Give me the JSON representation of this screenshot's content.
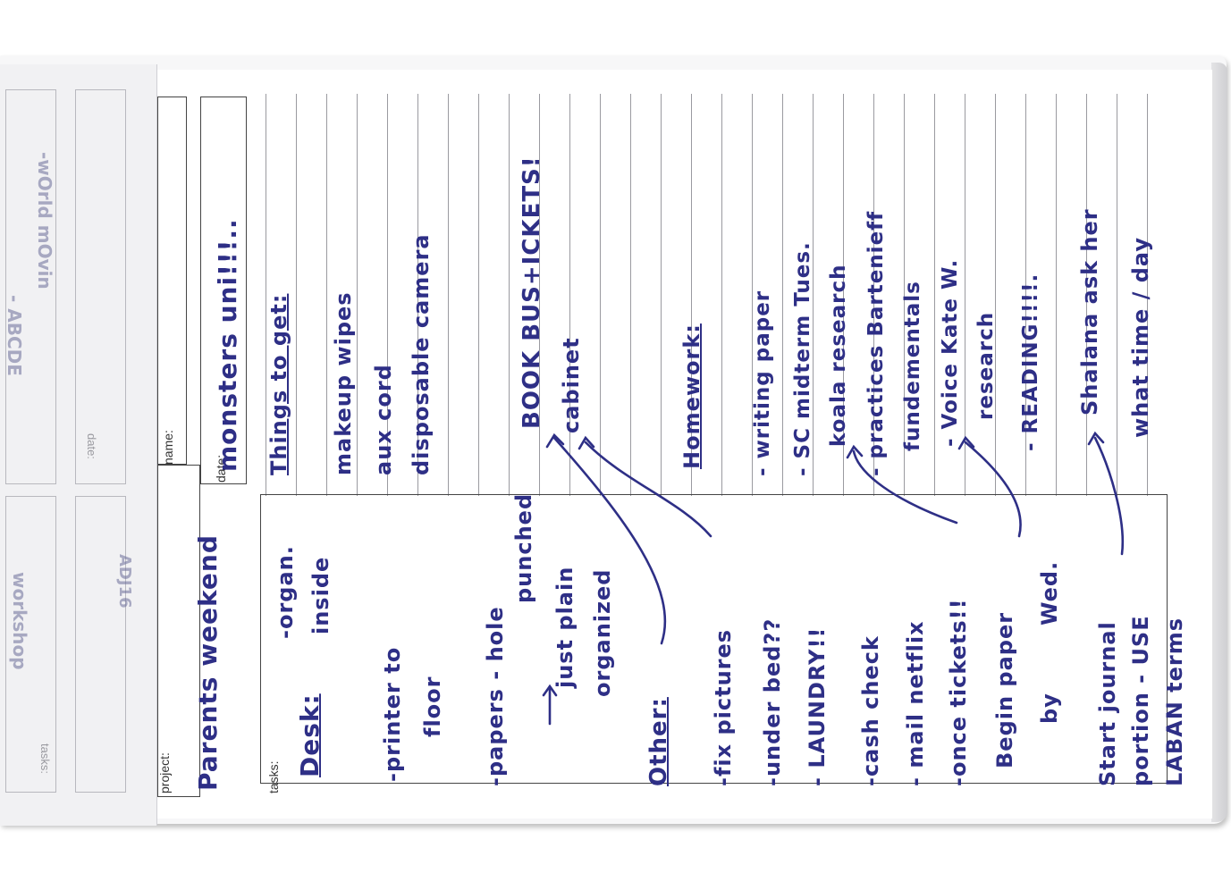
{
  "form_labels": {
    "project": "project:",
    "name": "name:",
    "date": "date:",
    "tasks": "tasks:"
  },
  "header": {
    "project_value": "Parents weekend",
    "date_value": "monsters uni!!!.."
  },
  "things_to_get": {
    "heading": "Things to get:",
    "items": [
      "makeup wipes",
      "aux cord",
      "disposable camera",
      "BOOK BUS+ICKETS!",
      "cabinet"
    ]
  },
  "homework": {
    "heading": "Homework:",
    "items": [
      "- writing paper",
      "- SC midterm Tues.",
      "koala research",
      "- practices Bartenieff",
      "fundementals",
      "- Voice Kate W.",
      "research",
      "- READING!!!!."
    ],
    "note_line1": "Shalana ask her",
    "note_line2": "what time / day"
  },
  "desk": {
    "heading": "Desk:",
    "organ_line1": "-organ.",
    "organ_line2": "inside",
    "printer_line1": "-printer to",
    "printer_line2": "floor",
    "papers_line1": "-papers - hole",
    "papers_line2": "punched",
    "just_plain": "just plain",
    "organized": "organized"
  },
  "other": {
    "heading": "Other:",
    "items": [
      "-fix pictures",
      "-under bed??",
      "- LAUNDRY!!",
      "-cash check",
      "- mail netflix",
      "-once tickets!!"
    ],
    "begin_line1": "Begin paper",
    "begin_line2": "by",
    "begin_line3": "Wed.",
    "start_line1": "Start journal",
    "start_line2": "portion - USE",
    "start_line3": "LABAN terms"
  },
  "previous_sheet": {
    "line1": "-wOrld mOvin",
    "line2": "- ABCDE",
    "line3": "workshop",
    "line4": "ADJ16",
    "label_tasks": "tasks:",
    "label_date": "date:"
  },
  "ink_color": "#2e2f86"
}
